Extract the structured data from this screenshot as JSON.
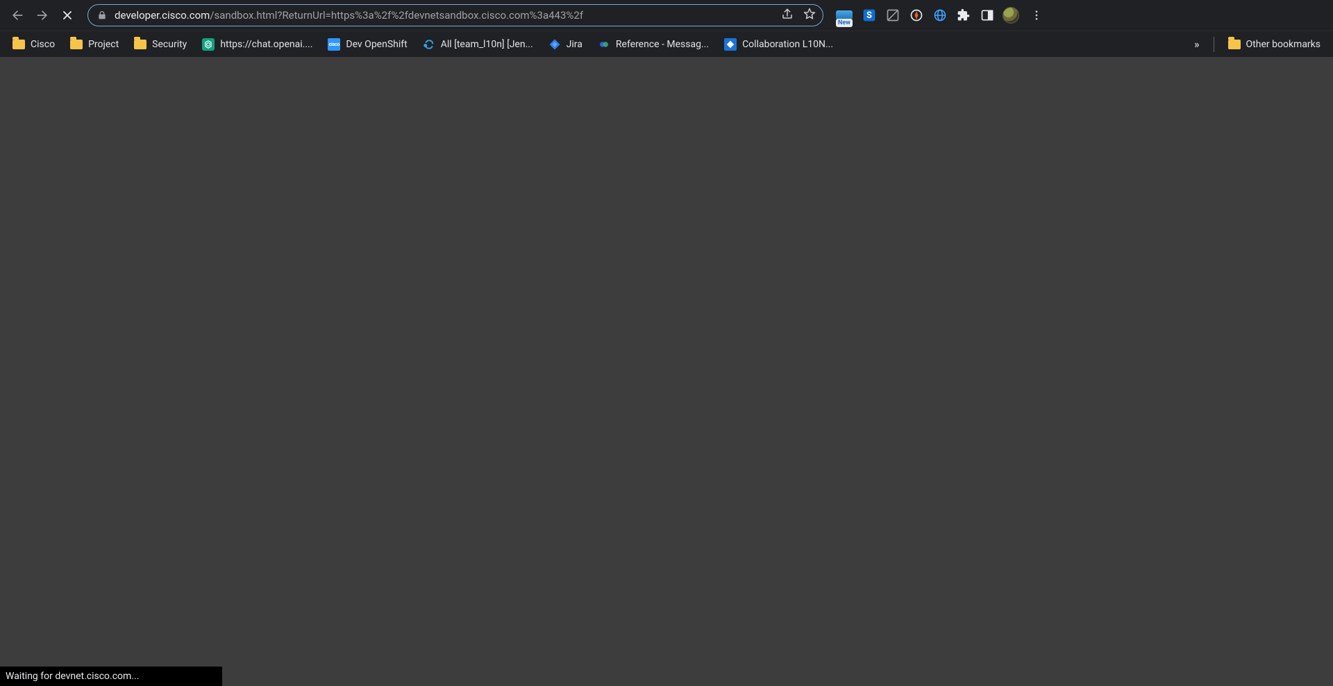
{
  "toolbar": {
    "url_host": "developer.cisco.com",
    "url_path": "/sandbox.html?ReturnUrl=https%3a%2f%2fdevnetsandbox.cisco.com%3a443%2f",
    "new_badge": "New"
  },
  "bookmarks": [
    {
      "type": "folder",
      "label": "Cisco"
    },
    {
      "type": "folder",
      "label": "Project"
    },
    {
      "type": "folder",
      "label": "Security"
    },
    {
      "type": "openai",
      "label": "https://chat.openai...."
    },
    {
      "type": "cisco",
      "label": "Dev OpenShift"
    },
    {
      "type": "loop",
      "label": "All [team_l10n] [Jen..."
    },
    {
      "type": "jira",
      "label": "Jira"
    },
    {
      "type": "webex",
      "label": "Reference - Messag..."
    },
    {
      "type": "box",
      "label": "Collaboration L10N..."
    }
  ],
  "other_bookmarks_label": "Other bookmarks",
  "status_text": "Waiting for devnet.cisco.com..."
}
